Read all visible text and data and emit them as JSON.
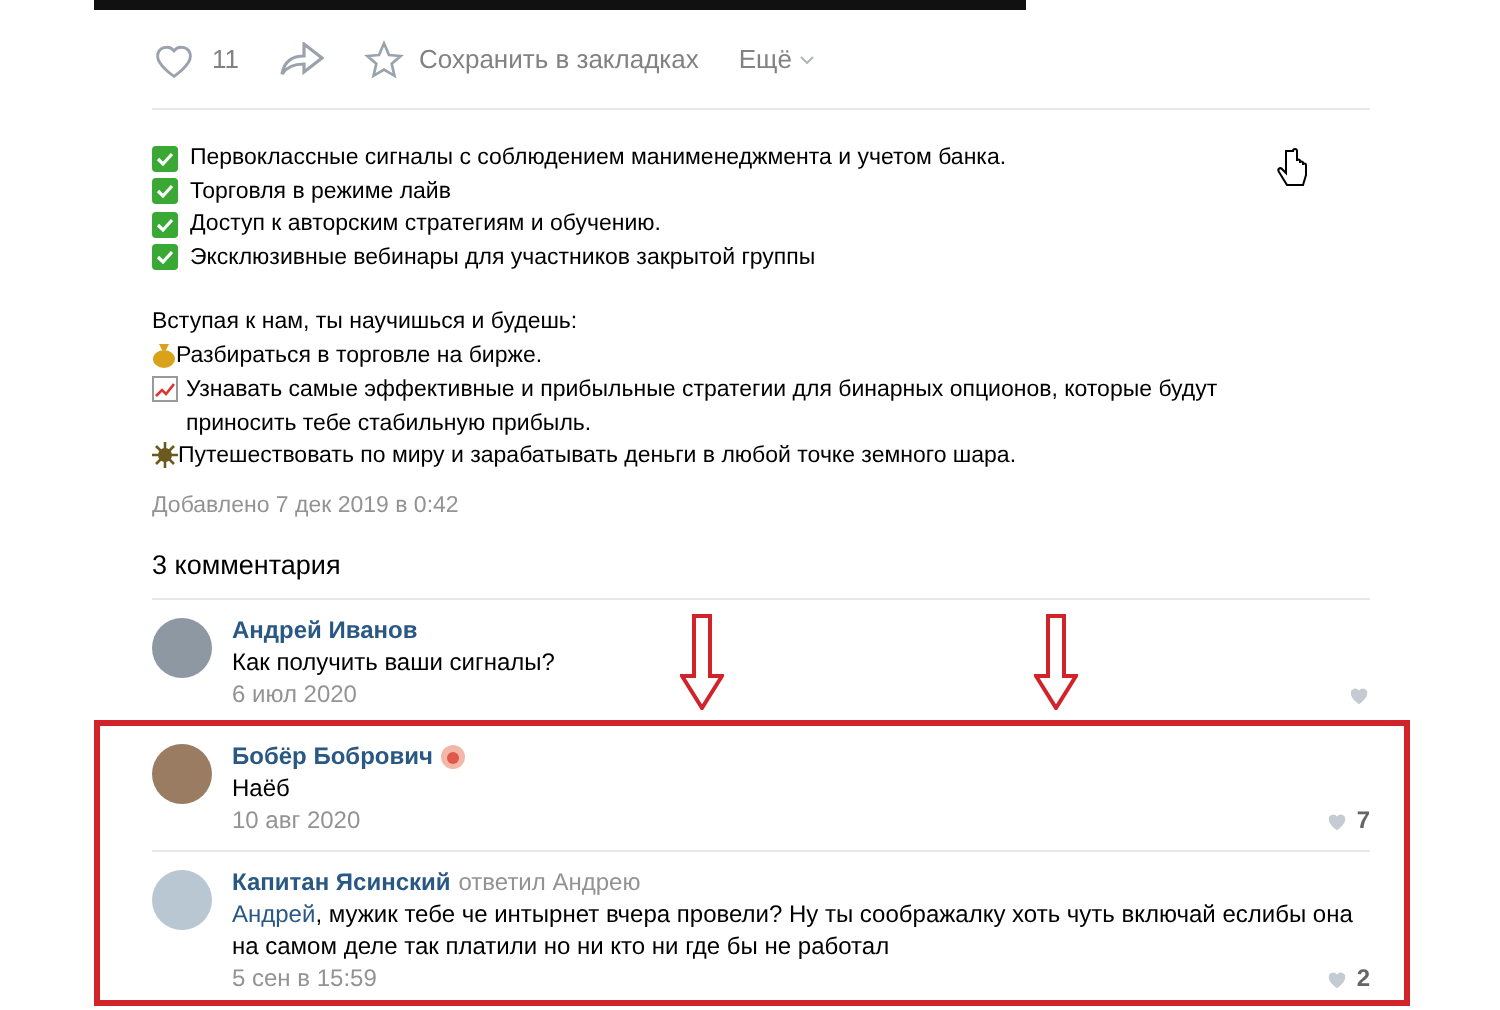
{
  "post_actions": {
    "likes": "11",
    "save": "Сохранить в закладках",
    "more": "Ещё"
  },
  "features": [
    "Первоклассные сигналы с соблюдением манименеджмента и учетом банка.",
    "Торговля в режиме лайв",
    "Доступ к авторским стратегиям и обучению.",
    "Эксклюзивные вебинары для участников закрытой группы"
  ],
  "intro": "Вступая к нам, ты научишься и будешь:",
  "benefits": [
    {
      "kind": "money",
      "text": "Разбираться в торговле на бирже."
    },
    {
      "kind": "chart",
      "text": "Узнавать самые эффективные и прибыльные стратегии для бинарных опционов, которые будут приносить тебе стабильную прибыль."
    },
    {
      "kind": "gear",
      "text": "Путешествовать по миру и зарабатывать деньги в любой точке земного шара."
    }
  ],
  "added": "Добавлено 7 дек 2019 в 0:42",
  "comments_title": "3 комментария",
  "comments": [
    {
      "author": "Андрей Иванов",
      "text": "Как получить ваши сигналы?",
      "date": "6 июл 2020",
      "highlighted": false,
      "badge": false
    },
    {
      "author": "Бобёр Бобрович",
      "text": "Наёб",
      "date": "10 авг 2020",
      "likes": "7",
      "highlighted": true,
      "badge": true
    },
    {
      "author": "Капитан Ясинский",
      "reply_to": "ответил Андрею",
      "mention": "Андрей",
      "text": ", мужик тебе че интырнет вчера провели? Ну ты соображалку хоть чуть включай еслибы она на самом деле так платили но ни кто ни где бы не работал",
      "date": "5 сен в 15:59",
      "likes": "2",
      "highlighted": true,
      "badge": false
    }
  ]
}
